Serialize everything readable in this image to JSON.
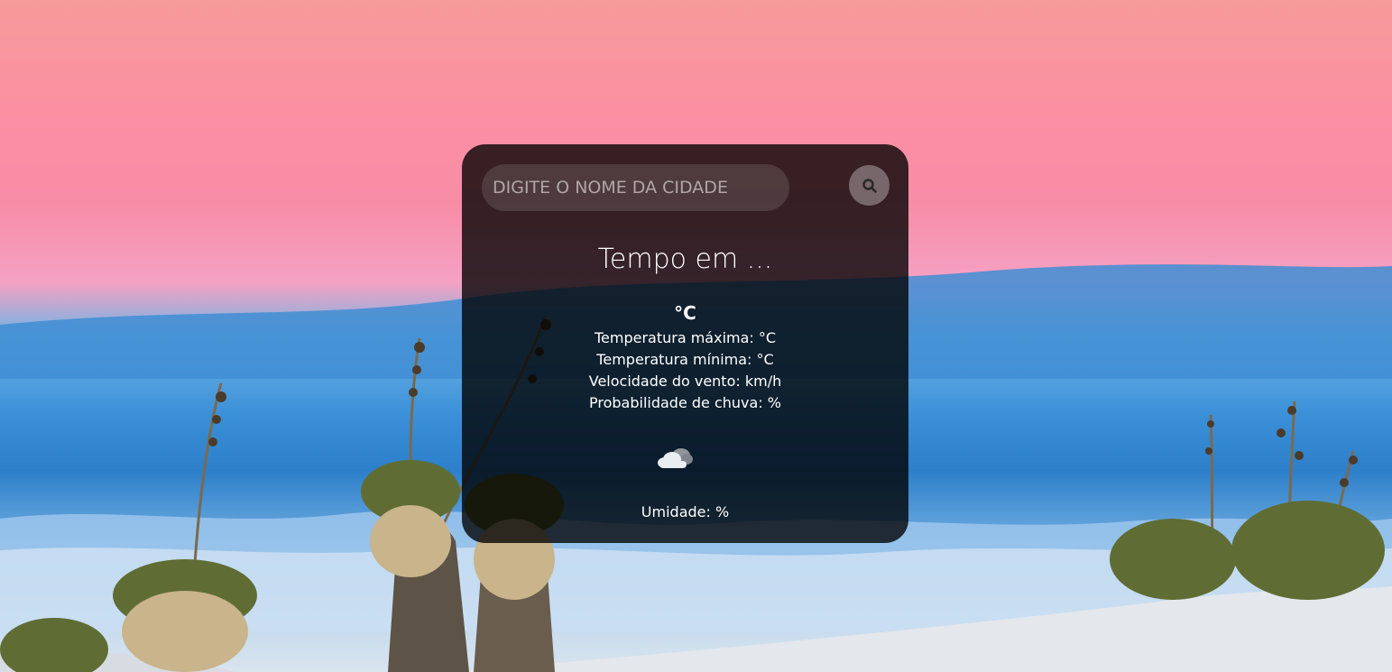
{
  "search": {
    "placeholder": "DIGITE O NOME DA CIDADE",
    "value": ""
  },
  "weather": {
    "title": "Tempo em ...",
    "temperature": "°C",
    "details": [
      "Temperatura máxima: °C",
      "Temperatura mínima: °C",
      "Velocidade do vento: km/h",
      "Probabilidade de chuva: %"
    ],
    "icon": "cloud-icon",
    "humidity": "Umidade: %"
  },
  "colors": {
    "card_background": "#000000",
    "text": "#ffffff"
  },
  "icons": {
    "search": "search-icon",
    "weather": "cloud-icon"
  }
}
